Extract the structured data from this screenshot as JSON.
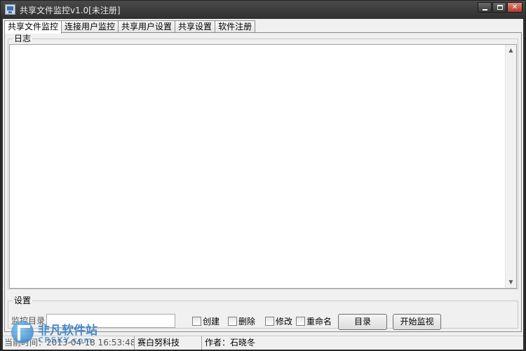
{
  "window": {
    "title": "共享文件监控v1.0[未注册]",
    "icon": "monitor-icon"
  },
  "tabs": [
    {
      "label": "共享文件监控",
      "active": true
    },
    {
      "label": "连接用户监控",
      "active": false
    },
    {
      "label": "共享用户设置",
      "active": false
    },
    {
      "label": "共享设置",
      "active": false
    },
    {
      "label": "软件注册",
      "active": false
    }
  ],
  "log": {
    "group_label": "日志"
  },
  "settings": {
    "group_label": "设置",
    "monitor_dir_label": "监控目录",
    "monitor_dir_value": "",
    "checkboxes": {
      "create": "创建",
      "delete": "删除",
      "modify": "修改",
      "rename": "重命名"
    },
    "dir_button": "目录",
    "start_button": "开始监视"
  },
  "status": {
    "time": "当前时间：2013-04-18 16:53:48",
    "company": "赛白努科技",
    "author": "作者：石晓冬"
  },
  "watermark": {
    "name": "非凡软件站",
    "site": "CRSKY.com"
  }
}
